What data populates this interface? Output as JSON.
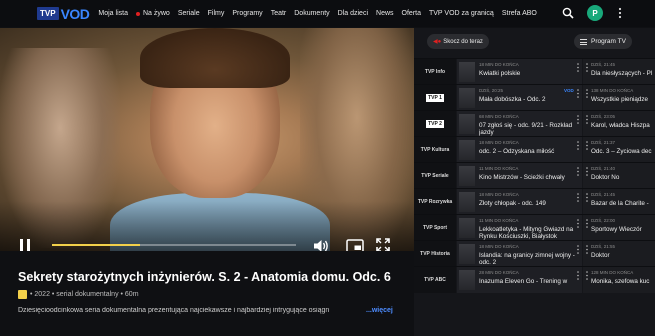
{
  "header": {
    "logo_tvp": "TVP",
    "logo_vod": "VOD",
    "nav": [
      "Moja lista",
      "Na żywo",
      "Seriale",
      "Filmy",
      "Programy",
      "Teatr",
      "Dokumenty",
      "Dla dzieci",
      "News",
      "Oferta",
      "TVP VOD za granicą",
      "Strefa ABO"
    ],
    "avatar_letter": "P"
  },
  "player": {
    "progress_fraction": 0.36
  },
  "info": {
    "title": "Sekrety starożytnych inżynierów. S. 2 - Anatomia domu. Odc. 6",
    "meta": "• 2022 • serial dokumentalny • 60m",
    "description": "Dziesięcioodcinkowa seria dokumentalna prezentująca najciekawsze i najbardziej intrygujące osiągn",
    "more": "...więcej"
  },
  "sidebar": {
    "jump_label": "Skocz do teraz",
    "program_label": "Program TV",
    "rows": [
      {
        "channel": "TVP Info",
        "now_label": "18 MIN DO KOŃCA",
        "now": "Kwiatki polskie",
        "vod": "",
        "next_label": "DZIŚ, 21:45",
        "next": "Dla niesłyszących - Pl"
      },
      {
        "channel": "TVP 1",
        "now_label": "DZIŚ, 20:25",
        "now": "Mała dobószka - Odc. 2",
        "vod": "VOD",
        "next_label": "138 MIN DO KOŃCA",
        "next": "Wszystkie pieniądze"
      },
      {
        "channel": "TVP 2",
        "now_label": "68 MIN DO KOŃCA",
        "now": "07 zgłoś się - odc. 9/21 - Rozkład jazdy",
        "vod": "",
        "next_label": "DZIŚ, 23:05",
        "next": "Karol, władca Hiszpa"
      },
      {
        "channel": "TVP Kultura",
        "now_label": "18 MIN DO KOŃCA",
        "now": "odc. 2 – Odzyskana miłość",
        "vod": "",
        "next_label": "DZIŚ, 21:37",
        "next": "Odc. 3 – Życiowa dec"
      },
      {
        "channel": "TVP Seriale",
        "now_label": "11 MIN DO KOŃCA",
        "now": "Kino Mistrzów - Ścieżki chwały",
        "vod": "",
        "next_label": "DZIŚ, 21:40",
        "next": "Doktor No"
      },
      {
        "channel": "TVP Rozrywka",
        "now_label": "18 MIN DO KOŃCA",
        "now": "Złoty chłopak - odc. 149",
        "vod": "",
        "next_label": "DZIŚ, 21:45",
        "next": "Bazar de la Charite -"
      },
      {
        "channel": "TVP Sport",
        "now_label": "11 MIN DO KOŃCA",
        "now": "Lekkoatletyka - Mityng Gwiazd na Rynku Kościuszki, Białystok",
        "vod": "",
        "next_label": "DZIŚ, 22:00",
        "next": "Sportowy Wieczór"
      },
      {
        "channel": "TVP Historia",
        "now_label": "18 MIN DO KOŃCA",
        "now": "Islandia: na granicy zimnej wojny - odc. 2",
        "vod": "",
        "next_label": "DZIŚ, 21:55",
        "next": "Doktor"
      },
      {
        "channel": "TVP ABC",
        "now_label": "28 MIN DO KOŃCA",
        "now": "Inazuma Eleven Go - Trening w",
        "vod": "",
        "next_label": "128 MIN DO KOŃCA",
        "next": "Monika, szefowa kuc"
      }
    ]
  },
  "colors": {
    "accent_blue": "#3a86ff",
    "live_red": "#e02020",
    "avatar_green": "#19a97b",
    "progress_yellow": "#f2d04a"
  }
}
